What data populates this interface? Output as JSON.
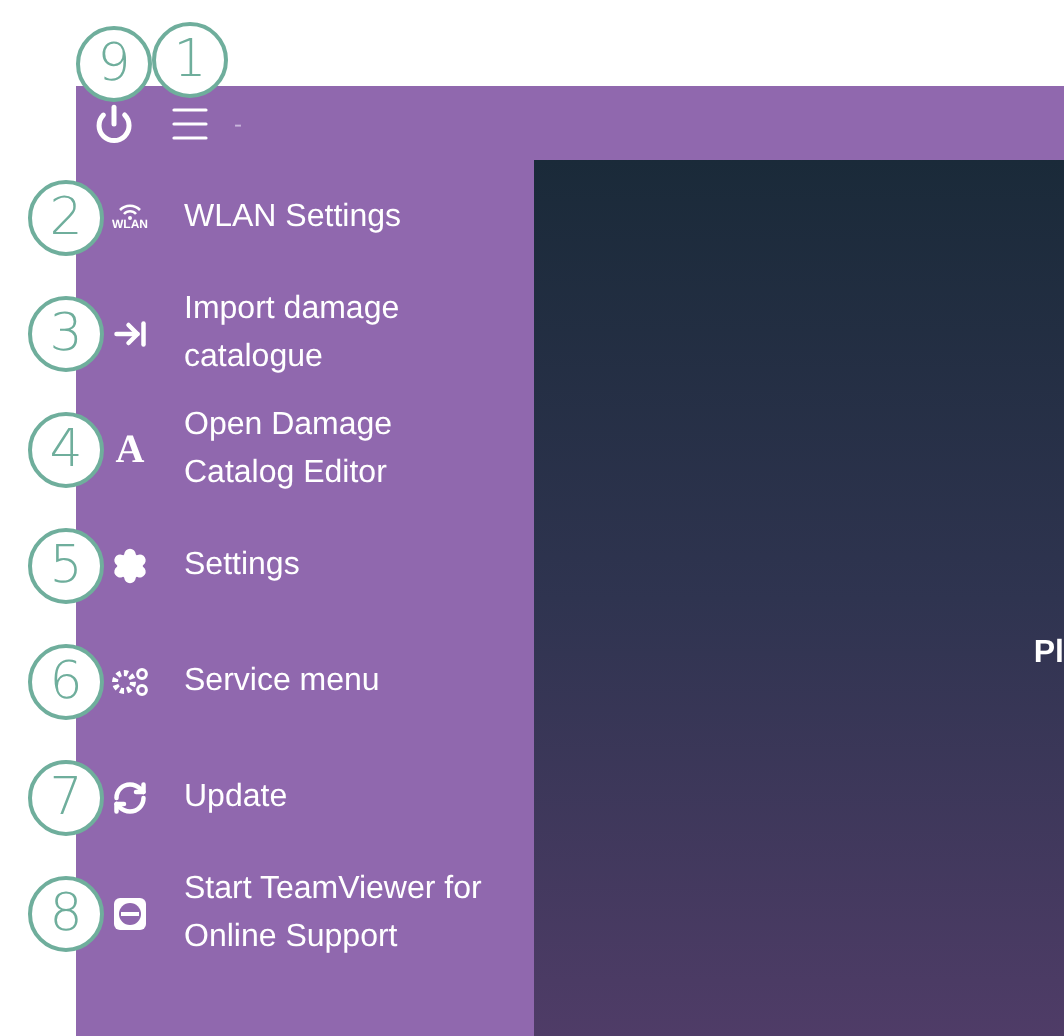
{
  "top_bar": {
    "power_callout": "9",
    "menu_callout": "1",
    "title": "-"
  },
  "menu_items": [
    {
      "callout": "2",
      "icon_text": "WLAN",
      "label": "WLAN Settings"
    },
    {
      "callout": "3",
      "label": "Import damage catalogue"
    },
    {
      "callout": "4",
      "icon_text": "A",
      "label": "Open Damage Catalog Editor"
    },
    {
      "callout": "5",
      "label": "Settings"
    },
    {
      "callout": "6",
      "label": "Service menu"
    },
    {
      "callout": "7",
      "label": "Update"
    },
    {
      "callout": "8",
      "label": "Start TeamViewer for Online Support"
    }
  ],
  "main_panel": {
    "text": "Pl"
  }
}
